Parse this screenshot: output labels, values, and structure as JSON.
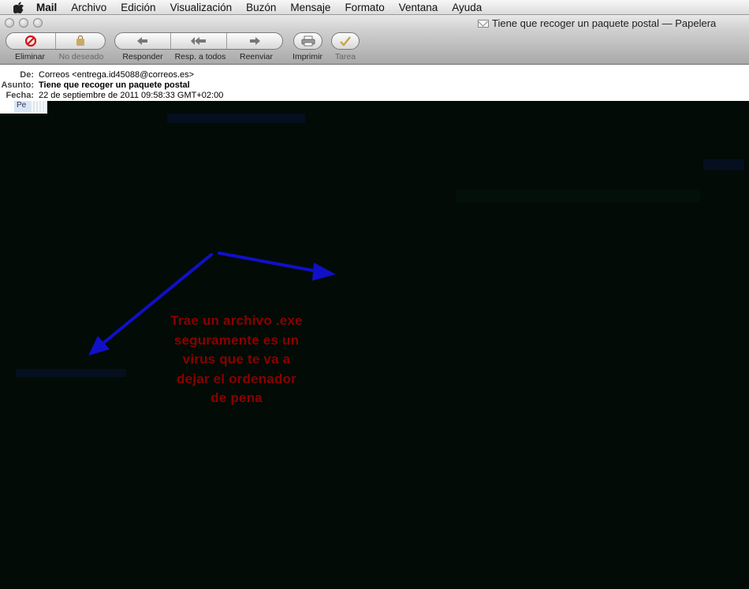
{
  "menubar": {
    "app_name": "Mail",
    "items": [
      "Archivo",
      "Edición",
      "Visualización",
      "Buzón",
      "Mensaje",
      "Formato",
      "Ventana",
      "Ayuda"
    ]
  },
  "window": {
    "title": "Tiene que recoger un paquete postal — Papelera"
  },
  "toolbar": {
    "delete_label": "Eliminar",
    "junk_label": "No deseado",
    "reply_label": "Responder",
    "reply_all_label": "Resp. a todos",
    "forward_label": "Reenviar",
    "print_label": "Imprimir",
    "todo_label": "Tarea"
  },
  "message": {
    "from_key": "De:",
    "from_value": "Correos <entrega.id45088@correos.es>",
    "subject_key": "Asunto:",
    "subject_value": "Tiene que recoger un paquete postal",
    "date_key": "Fecha:",
    "date_value": "22 de septiembre de 2011 09:58:33 GMT+02:00",
    "attachment_prefix": "Pe"
  },
  "annotation": {
    "lines": [
      "Trae un archivo .exe",
      "seguramente es un",
      "virus que te va a",
      "dejar el ordenador",
      "de pena"
    ]
  },
  "colors": {
    "annotation_text": "#8a0000",
    "arrow": "#1010c8",
    "body_background": "#020b05"
  }
}
